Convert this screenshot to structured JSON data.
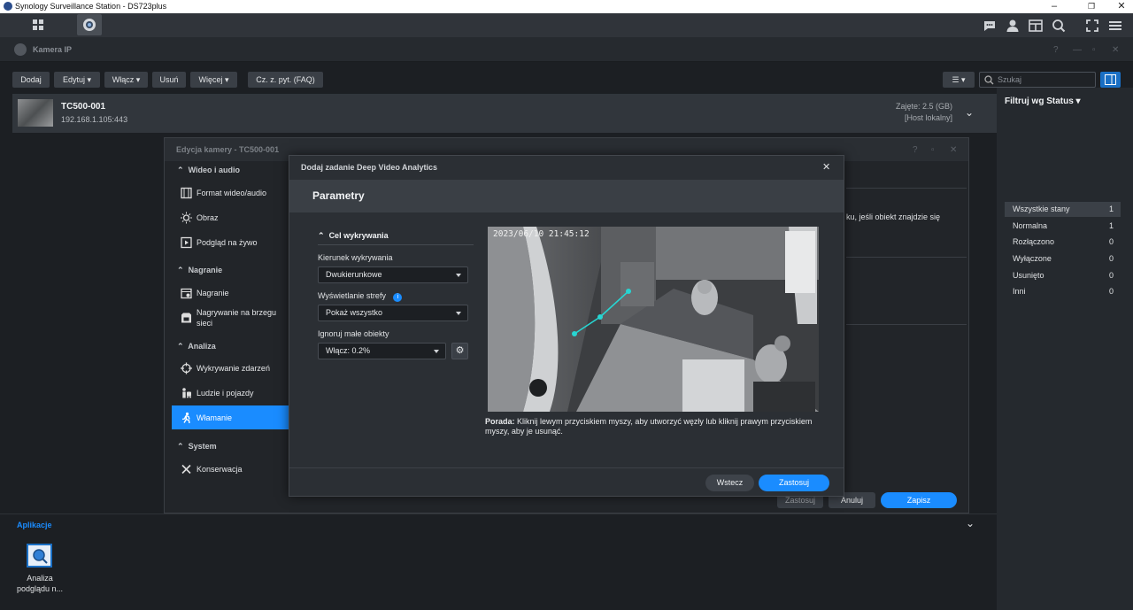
{
  "titlebar": {
    "title": "Synology Surveillance Station - DS723plus"
  },
  "window": {
    "title": "Kamera IP"
  },
  "toolbar": {
    "add": "Dodaj",
    "edit": "Edytuj",
    "enable": "Włącz",
    "delete": "Usuń",
    "more": "Więcej",
    "faq": "Cz. z. pyt. (FAQ)",
    "search_placeholder": "Szukaj"
  },
  "camera": {
    "name": "TC500-001",
    "address": "192.168.1.105:443",
    "used": "Zajęte: 2.5 (GB)",
    "host": "[Host lokalny]"
  },
  "filter": {
    "title": "Filtruj wg Status",
    "items": [
      {
        "label": "Wszystkie stany",
        "count": "1"
      },
      {
        "label": "Normalna",
        "count": "1"
      },
      {
        "label": "Rozłączono",
        "count": "0"
      },
      {
        "label": "Wyłączone",
        "count": "0"
      },
      {
        "label": "Usunięto",
        "count": "0"
      },
      {
        "label": "Inni",
        "count": "0"
      }
    ]
  },
  "edit_dialog": {
    "title": "Edycja kamery - TC500-001",
    "sections": {
      "video": "Wideo i audio",
      "recording": "Nagranie",
      "analysis": "Analiza",
      "system": "System"
    },
    "items": {
      "format": "Format wideo/audio",
      "image": "Obraz",
      "live": "Podgląd na żywo",
      "rec": "Nagranie",
      "edge": "Nagrywanie na brzegu sieci",
      "events": "Wykrywanie zdarzeń",
      "people": "Ludzie i pojazdy",
      "intrusion": "Włamanie",
      "maint": "Konserwacja"
    },
    "clipped_text": "ku, jeśli obiekt znajdzie się",
    "buttons": {
      "apply": "Zastosuj",
      "cancel": "Anuluj",
      "save": "Zapisz"
    }
  },
  "modal": {
    "title": "Dodaj zadanie Deep Video Analytics",
    "section": "Parametry",
    "group": "Cel wykrywania",
    "direction_label": "Kierunek wykrywania",
    "direction_value": "Dwukierunkowe",
    "zone_label": "Wyświetlanie strefy",
    "zone_value": "Pokaż wszystko",
    "small_label": "Ignoruj małe obiekty",
    "small_value": "Włącz: 0.2%",
    "timestamp": "2023/06/10 21:45:12",
    "tip_bold": "Porada:",
    "tip_text": "Kliknij lewym przyciskiem myszy, aby utworzyć węzły lub kliknij prawym przyciskiem myszy, aby je usunąć.",
    "back": "Wstecz",
    "apply": "Zastosuj"
  },
  "apps": {
    "title": "Aplikacje",
    "app_label": "Analiza podglądu n..."
  },
  "colors": {
    "accent": "#1a8cff",
    "selected_sidebar": "#1a8cff",
    "line": "#27d5d2"
  }
}
